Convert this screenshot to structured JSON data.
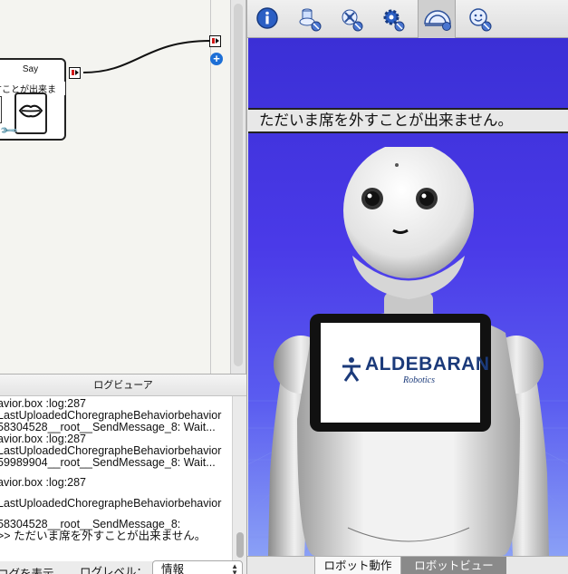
{
  "flow": {
    "box_title": "Say",
    "box_text": "すことが出来ま",
    "icons": [
      "lips-icon",
      "wrench-icon",
      "add-output-icon"
    ]
  },
  "log": {
    "header": "ログビューア",
    "lines": [
      "avior.box :log:287",
      "LastUploadedChoregrapheBehaviorbehavior",
      "58304528__root__SendMessage_8: Wait...",
      "avior.box :log:287",
      "LastUploadedChoregrapheBehaviorbehavior",
      "59989904__root__SendMessage_8: Wait...",
      "avior.box :log:287",
      "LastUploadedChoregrapheBehaviorbehavior",
      "58304528__root__SendMessage_8:",
      ">> ただいま席を外すことが出来ません。"
    ],
    "show_label": "ログを表示",
    "level_label": "ログレベル：",
    "level_value": "情報"
  },
  "toolbar": {
    "buttons": [
      "info-icon",
      "robot-hardware-icon",
      "joint-icon",
      "settings-icon",
      "robot-view-icon",
      "face-icon"
    ]
  },
  "viewport": {
    "speech_text": "ただいま席を外すことが出来ません。",
    "tablet_logo": "ALDEBARAN",
    "tablet_sub": "Robotics"
  },
  "tabs": {
    "robot_motion": "ロボット動作",
    "robot_view": "ロボットビュー"
  },
  "colors": {
    "viewport_bg": "#4a3ae8",
    "tablet_frame": "#111111",
    "aldebaran_blue": "#1b3a7a",
    "eye_color": "#111111"
  }
}
